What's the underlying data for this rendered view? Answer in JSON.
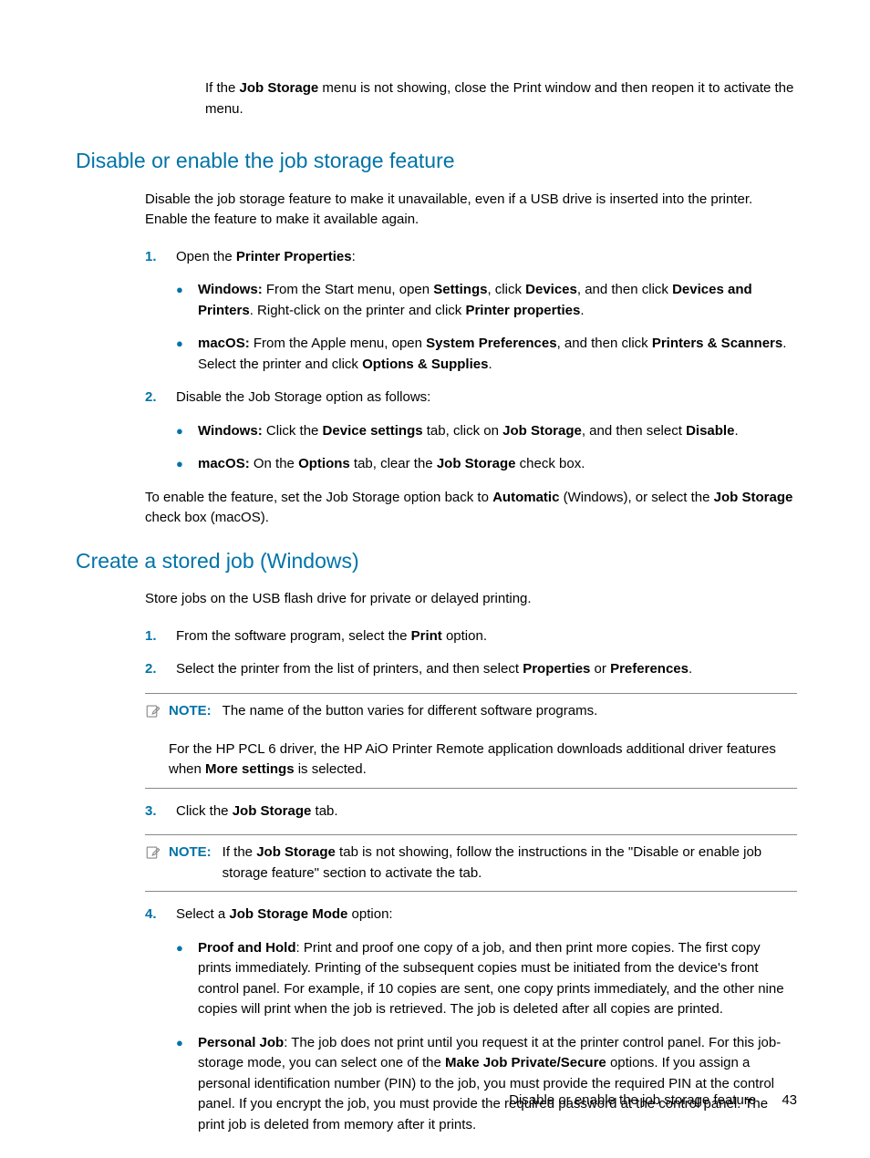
{
  "intro": {
    "prefix": "If the ",
    "bold1": "Job Storage",
    "suffix": " menu is not showing, close the Print window and then reopen it to activate the menu."
  },
  "section1": {
    "heading": "Disable or enable the job storage feature",
    "para1": "Disable the job storage feature to make it unavailable, even if a USB drive is inserted into the printer. Enable the feature to make it available again.",
    "step1_num": "1.",
    "step1_prefix": "Open the ",
    "step1_bold": "Printer Properties",
    "step1_suffix": ":",
    "b1_win_label": "Windows:",
    "b1_win_t1": " From the Start menu, open ",
    "b1_win_b1": "Settings",
    "b1_win_t2": ", click ",
    "b1_win_b2": "Devices",
    "b1_win_t3": ", and then click ",
    "b1_win_b3": "Devices and Printers",
    "b1_win_t4": ". Right-click on the printer and click ",
    "b1_win_b4": "Printer properties",
    "b1_win_t5": ".",
    "b1_mac_label": "macOS:",
    "b1_mac_t1": " From the Apple menu, open ",
    "b1_mac_b1": "System Preferences",
    "b1_mac_t2": ", and then click ",
    "b1_mac_b2": "Printers & Scanners",
    "b1_mac_t3": ". Select the printer and click ",
    "b1_mac_b3": "Options & Supplies",
    "b1_mac_t4": ".",
    "step2_num": "2.",
    "step2_text": "Disable the Job Storage option as follows:",
    "b2_win_label": "Windows:",
    "b2_win_t1": " Click the ",
    "b2_win_b1": "Device settings",
    "b2_win_t2": " tab, click on ",
    "b2_win_b2": "Job Storage",
    "b2_win_t3": ", and then select ",
    "b2_win_b3": "Disable",
    "b2_win_t4": ".",
    "b2_mac_label": "macOS:",
    "b2_mac_t1": " On the ",
    "b2_mac_b1": "Options",
    "b2_mac_t2": " tab, clear the ",
    "b2_mac_b2": "Job Storage",
    "b2_mac_t3": " check box.",
    "para2_t1": "To enable the feature, set the Job Storage option back to ",
    "para2_b1": "Automatic",
    "para2_t2": " (Windows), or select the ",
    "para2_b2": "Job Storage",
    "para2_t3": " check box (macOS)."
  },
  "section2": {
    "heading": "Create a stored job (Windows)",
    "para1": "Store jobs on the USB flash drive for private or delayed printing.",
    "step1_num": "1.",
    "step1_t1": "From the software program, select the ",
    "step1_b1": "Print",
    "step1_t2": " option.",
    "step2_num": "2.",
    "step2_t1": "Select the printer from the list of printers, and then select ",
    "step2_b1": "Properties",
    "step2_t2": " or ",
    "step2_b2": "Preferences",
    "step2_t3": ".",
    "note1_label": "NOTE:",
    "note1_text": "The name of the button varies for different software programs.",
    "note1_extra_t1": "For the HP PCL 6 driver, the HP AiO Printer Remote application downloads additional driver features when ",
    "note1_extra_b1": "More settings",
    "note1_extra_t2": " is selected.",
    "step3_num": "3.",
    "step3_t1": "Click the ",
    "step3_b1": "Job Storage",
    "step3_t2": " tab.",
    "note2_label": "NOTE:",
    "note2_t1": "If the ",
    "note2_b1": "Job Storage",
    "note2_t2": " tab is not showing, follow the instructions in the \"Disable or enable job storage feature\" section to activate the tab.",
    "step4_num": "4.",
    "step4_t1": "Select a ",
    "step4_b1": "Job Storage Mode",
    "step4_t2": " option:",
    "b4a_label": "Proof and Hold",
    "b4a_text": ": Print and proof one copy of a job, and then print more copies. The first copy prints immediately. Printing of the subsequent copies must be initiated from the device's front control panel. For example, if 10 copies are sent, one copy prints immediately, and the other nine copies will print when the job is retrieved. The job is deleted after all copies are printed.",
    "b4b_label": "Personal Job",
    "b4b_t1": ": The job does not print until you request it at the printer control panel. For this job-storage mode, you can select one of the ",
    "b4b_b1": "Make Job Private/Secure",
    "b4b_t2": " options. If you assign a personal identification number (PIN) to the job, you must provide the required PIN at the control panel. If you encrypt the job, you must provide the required password at the control panel. The print job is deleted from memory after it prints."
  },
  "footer": {
    "text": "Disable or enable the job storage feature",
    "page": "43"
  }
}
